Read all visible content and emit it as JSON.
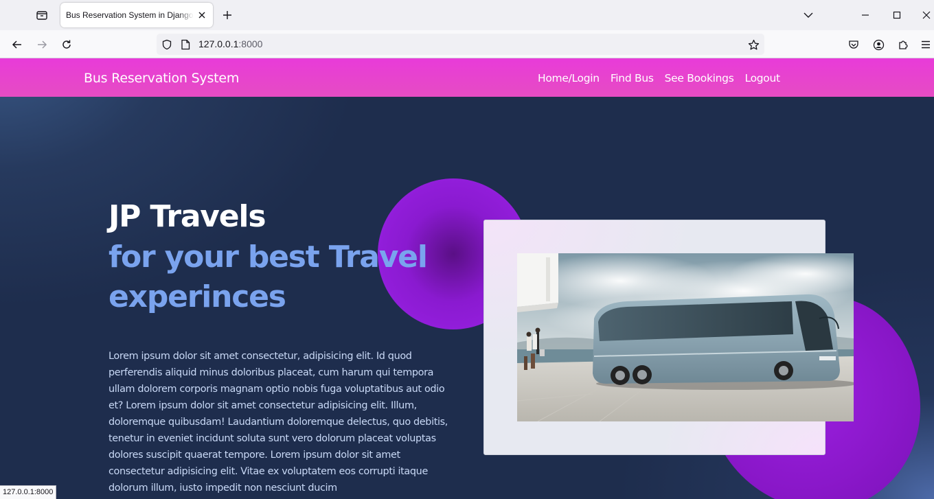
{
  "browser": {
    "tab_title": "Bus Reservation System in Django P",
    "url_host": "127.0.0.1",
    "url_port": ":8000",
    "status_url": "127.0.0.1:8000"
  },
  "site": {
    "brand": "Bus Reservation System",
    "menu": [
      "Home/Login",
      "Find Bus",
      "See Bookings",
      "Logout"
    ],
    "colors": {
      "header": "#e83bd9",
      "accent_text": "#7aa3ee",
      "blob": "#8a1ad0",
      "background": "#1e2d4d"
    }
  },
  "hero": {
    "title": "JP Travels",
    "subtitle": "for your best Travel experinces",
    "body": "Lorem ipsum dolor sit amet consectetur, adipisicing elit. Id quod perferendis aliquid minus doloribus placeat, cum harum qui tempora ullam dolorem corporis magnam optio nobis fuga voluptatibus aut odio et? Lorem ipsum dolor sit amet consectetur adipisicing elit. Illum, doloremque quibusdam! Laudantium doloremque delectus, quo debitis, tenetur in eveniet incidunt soluta sunt vero dolorum placeat voluptas dolores suscipit quaerat tempore. Lorem ipsum dolor sit amet consectetur adipisicing elit. Vitae ex voluptatem eos corrupti itaque dolorum illum, iusto impedit non nesciunt ducim"
  }
}
